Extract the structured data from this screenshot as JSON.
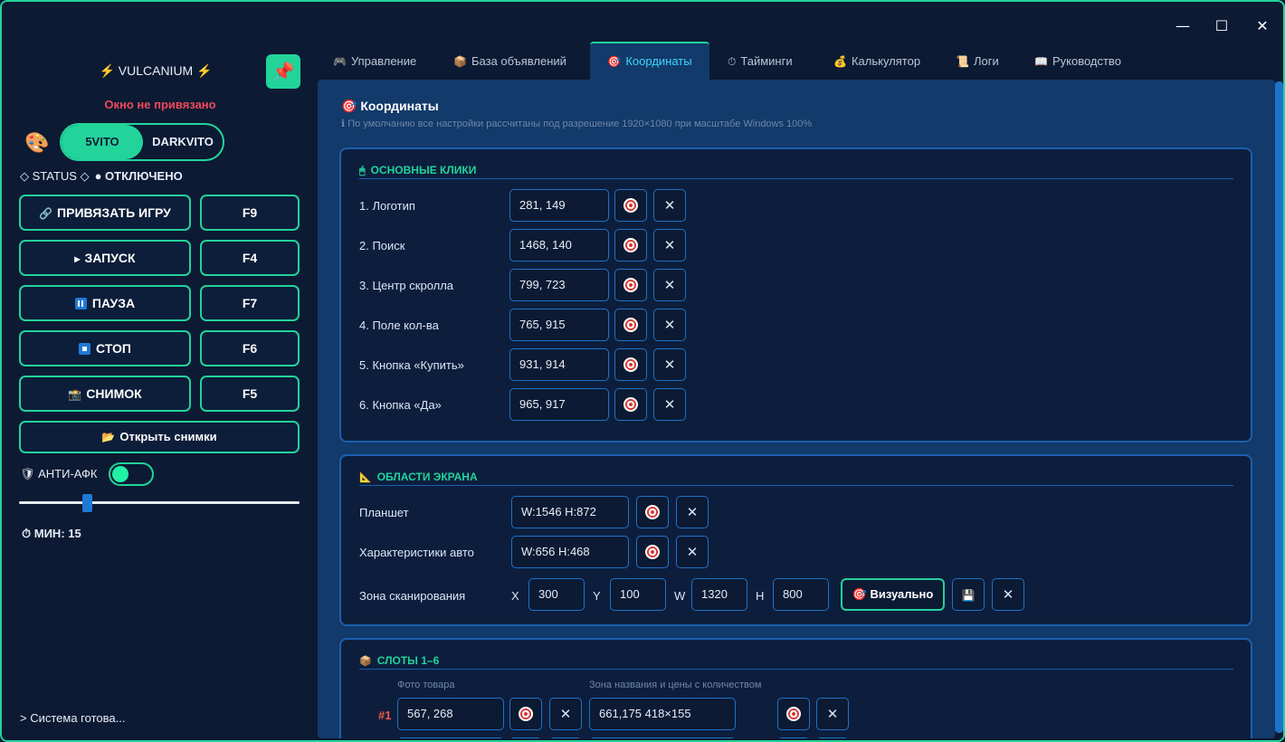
{
  "window": {
    "minimize_glyph": "—",
    "maximize_glyph": "☐",
    "close_glyph": "✕"
  },
  "sidebar": {
    "brand": "⚡ VULCANIUM ⚡",
    "pin_icon": "📌",
    "bind_status": "Окно не привязано",
    "palette_icon": "🎨",
    "mode_options": [
      "5VITO",
      "DARKVITO"
    ],
    "mode_selected": "5VITO",
    "status_label": "◇ STATUS ◇",
    "status_value": "● ОТКЛЮЧЕНО",
    "buttons": [
      {
        "icon": "🔗",
        "label": "ПРИВЯЗАТЬ ИГРУ",
        "hotkey": "F9"
      },
      {
        "icon": "▸",
        "label": "ЗАПУСК",
        "hotkey": "F4"
      },
      {
        "icon": "pause",
        "label": "ПАУЗА",
        "hotkey": "F7"
      },
      {
        "icon": "stop",
        "label": "СТОП",
        "hotkey": "F6"
      },
      {
        "icon": "📸",
        "label": "СНИМОК",
        "hotkey": "F5"
      }
    ],
    "open_snapshots": {
      "icon": "📂",
      "label": "Открыть снимки"
    },
    "antiafk_label": "🛡 АНТИ-АФК",
    "antiafk_enabled": true,
    "slider_value_min": 15,
    "min_label": "⏱ МИН: 15",
    "console": "> Система готова..."
  },
  "tabs": [
    {
      "icon": "🎮",
      "label": "Управление"
    },
    {
      "icon": "📦",
      "label": "База объявлений"
    },
    {
      "icon": "🎯",
      "label": "Координаты",
      "active": true
    },
    {
      "icon": "⏱",
      "label": "Тайминги"
    },
    {
      "icon": "💰",
      "label": "Калькулятор"
    },
    {
      "icon": "📜",
      "label": "Логи"
    },
    {
      "icon": "📖",
      "label": "Руководство"
    }
  ],
  "main": {
    "title": "🎯 Координаты",
    "subtitle": "ℹ  По умолчанию все настройки рассчитаны под разрешение 1920×1080 при масштабе Windows 100%",
    "clicks": {
      "title": "ОСНОВНЫЕ КЛИКИ",
      "icon": "🖱",
      "rows": [
        {
          "label": "1. Логотип",
          "value": "281, 149"
        },
        {
          "label": "2. Поиск",
          "value": "1468, 140"
        },
        {
          "label": "3. Центр скролла",
          "value": "799, 723"
        },
        {
          "label": "4. Поле кол-ва",
          "value": "765, 915"
        },
        {
          "label": "5. Кнопка «Купить»",
          "value": "931, 914"
        },
        {
          "label": "6. Кнопка «Да»",
          "value": "965, 917"
        }
      ]
    },
    "areas": {
      "title": "ОБЛАСТИ ЭКРАНА",
      "icon": "📐",
      "rows": [
        {
          "label": "Планшет",
          "value": "W:1546 H:872"
        },
        {
          "label": "Характеристики авто",
          "value": "W:656 H:468"
        }
      ],
      "scan_label": "Зона сканирования",
      "scan": {
        "x_label": "X",
        "x": "300",
        "y_label": "Y",
        "y": "100",
        "w_label": "W",
        "w": "1320",
        "h_label": "H",
        "h": "800"
      },
      "visual_button": "🎯 Визуально",
      "save_icon": "💾"
    },
    "slots": {
      "title": "СЛОТЫ 1–6",
      "icon": "📦",
      "col_photo": "Фото товара",
      "col_zone": "Зона названия и цены с количеством",
      "rows": [
        {
          "num": "#1",
          "photo": "567, 268",
          "zone": "661,175 418×155"
        }
      ]
    }
  },
  "colors": {
    "accent": "#22d39a",
    "panel_bg": "#0d1e3d",
    "main_bg": "#123a6a",
    "danger": "#f0495a",
    "border_blue": "#1f72c9"
  }
}
